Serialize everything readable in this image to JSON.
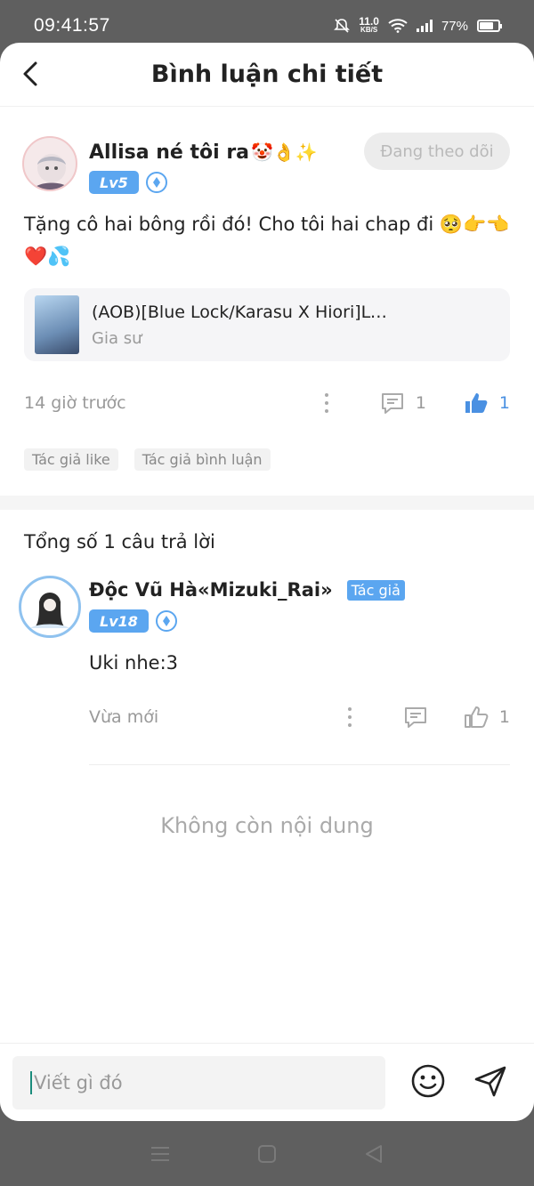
{
  "status_bar": {
    "time": "09:41:57",
    "net_speed_value": "11.0",
    "net_speed_unit": "KB/S",
    "battery": "77%",
    "battery_level": 0.77
  },
  "header": {
    "title": "Bình luận chi tiết"
  },
  "comment": {
    "username": "Allisa né tôi ra",
    "username_emoji": "🤡👌✨",
    "level": "Lv5",
    "follow_label": "Đang theo dõi",
    "text": "Tặng cô hai bông rồi đó! Cho tôi hai chap đi 🥺👉👈 ❤️💦",
    "book": {
      "title": "(AOB)[Blue Lock/Karasu X Hiori]Lov...",
      "subtitle": "Gia sư"
    },
    "time": "14 giờ trước",
    "reply_count": "1",
    "like_count": "1",
    "tags": [
      "Tác giả like",
      "Tác giả bình luận"
    ]
  },
  "replies": {
    "title": "Tổng số 1 câu trả lời",
    "items": [
      {
        "username": "Độc Vũ Hà«Mizuki_Rai»",
        "author_tag": "Tác giả",
        "level": "Lv18",
        "text": "Uki nhe:3",
        "time": "Vừa mới",
        "like_count": "1"
      }
    ]
  },
  "no_more": "Không còn nội dung",
  "input": {
    "placeholder": "Viết gì đó"
  },
  "colors": {
    "accent": "#5ba6f0",
    "like_active": "#4a90e2"
  }
}
